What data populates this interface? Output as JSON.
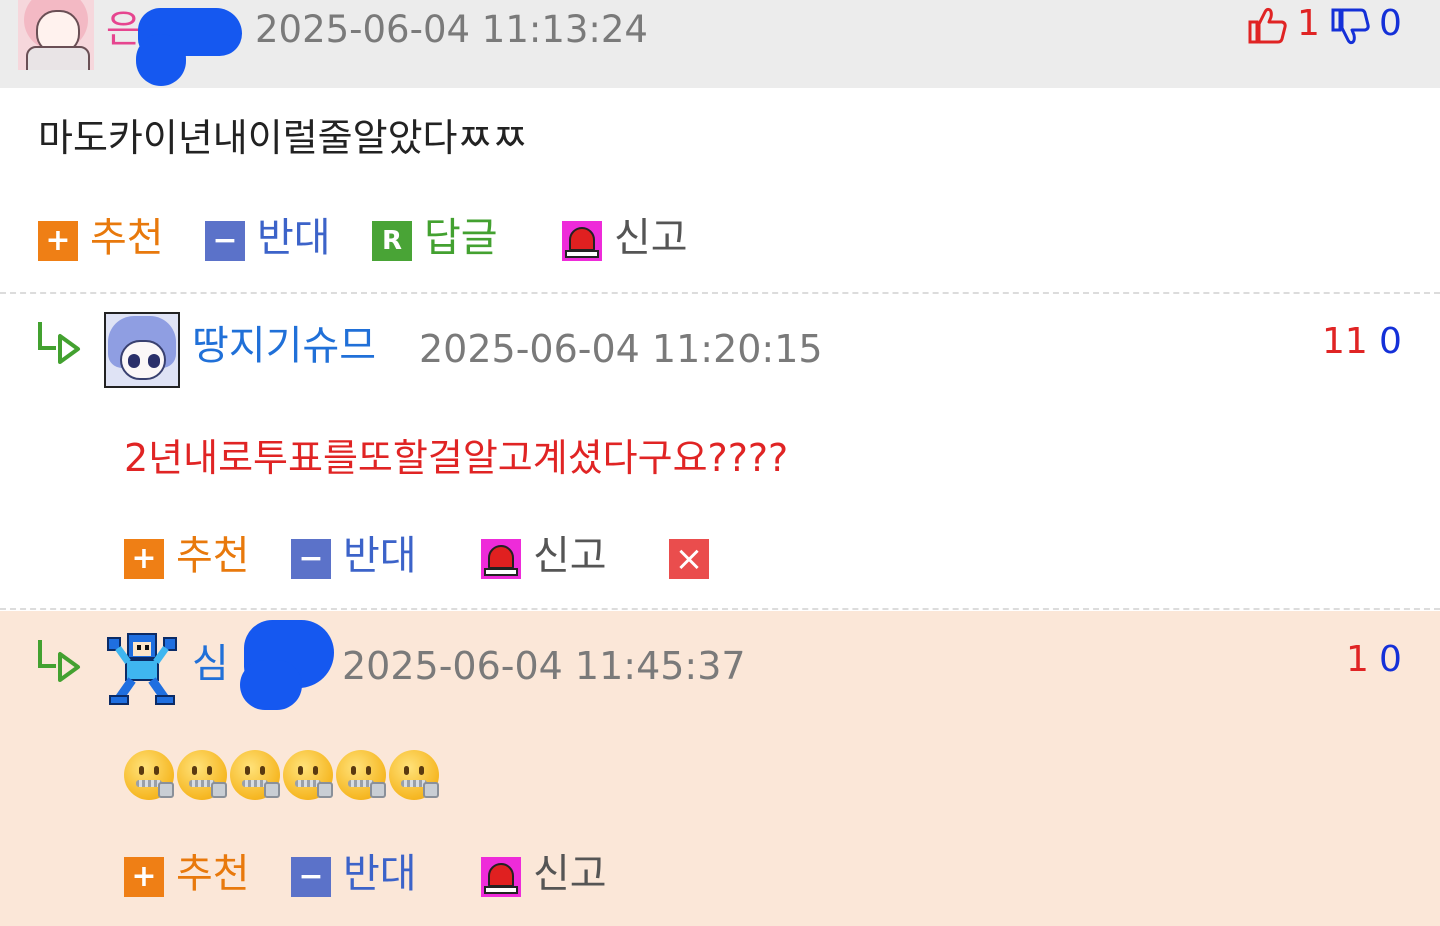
{
  "comments": [
    {
      "nickname_visible": "은",
      "timestamp": "2025-06-04 11:13:24",
      "votes": {
        "up": "1",
        "down": "0"
      },
      "body": "마도카이년내이럴줄알았다ㅉㅉ",
      "actions": {
        "recommend": "추천",
        "oppose": "반대",
        "reply": "답글",
        "report": "신고"
      },
      "reply_box_glyph": "R",
      "plus_glyph": "+",
      "minus_glyph": "−"
    },
    {
      "nickname": "땅지기슈므",
      "timestamp": "2025-06-04 11:20:15",
      "votes": {
        "up": "11",
        "down": "0"
      },
      "body": "2년내로투표를또할걸알고계셨다구요????",
      "actions": {
        "recommend": "추천",
        "oppose": "반대",
        "report": "신고"
      },
      "delete_glyph": "×",
      "plus_glyph": "+",
      "minus_glyph": "−"
    },
    {
      "nickname_visible": "심",
      "timestamp": "2025-06-04 11:45:37",
      "votes": {
        "up": "1",
        "down": "0"
      },
      "emoji_count": 6,
      "emoji_name": "zipper-mouth-face",
      "actions": {
        "recommend": "추천",
        "oppose": "반대",
        "report": "신고"
      },
      "plus_glyph": "+",
      "minus_glyph": "−"
    }
  ],
  "colors": {
    "nickname_pink": "#e6458f",
    "nickname_blue": "#2070d8",
    "vote_up": "#e02424",
    "vote_down": "#1430d8",
    "recommend": "#ef7f15",
    "oppose": "#5b72c9",
    "reply": "#49a436",
    "report": "#ee2bd9",
    "highlight_bg": "#fbe7d8"
  },
  "icons": [
    "thumbs-up-icon",
    "thumbs-down-icon",
    "reply-arrow-icon",
    "siren-icon",
    "delete-icon",
    "zipper-mouth-face-emoji"
  ]
}
